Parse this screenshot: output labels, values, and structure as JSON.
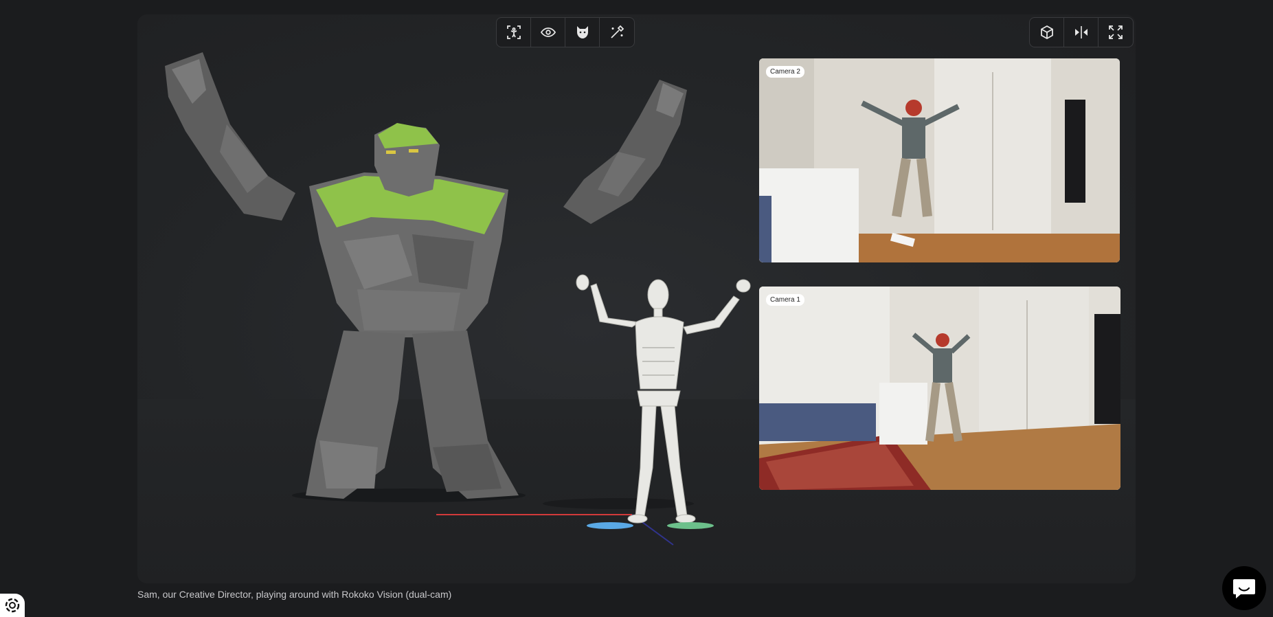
{
  "toolbar_left": {
    "buttons": [
      {
        "icon": "body-focus-icon"
      },
      {
        "icon": "eye-icon"
      },
      {
        "icon": "character-mask-icon"
      },
      {
        "icon": "magic-wand-icon"
      }
    ]
  },
  "toolbar_right": {
    "buttons": [
      {
        "icon": "cube-icon"
      },
      {
        "icon": "mirror-icon"
      },
      {
        "icon": "fullscreen-icon"
      }
    ]
  },
  "cameras": {
    "top_label": "Camera 2",
    "bottom_label": "Camera 1"
  },
  "caption": "Sam, our Creative Director, playing around with Rokoko Vision (dual-cam)",
  "colors": {
    "page_bg": "#1b1c1e",
    "viewport_bg": "#232527",
    "golem_rock": "#6b6b6b",
    "golem_moss": "#8fc24a",
    "mannequin": "#e8e8e4",
    "foot_left_marker": "#5aa9e6",
    "foot_right_marker": "#6cc08b",
    "axis_x": "#d23a3a",
    "axis_z": "#3a3fd2"
  }
}
